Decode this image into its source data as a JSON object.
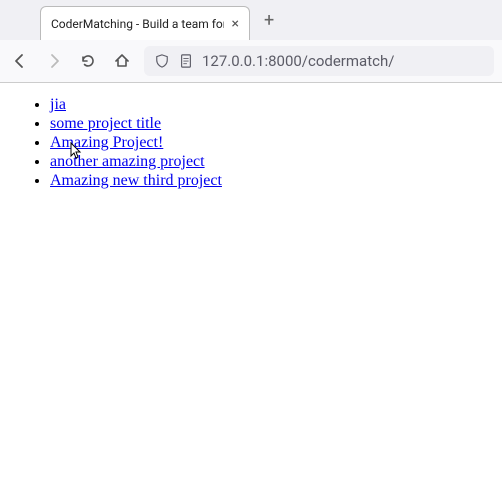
{
  "tab": {
    "title": "CoderMatching - Build a team for y"
  },
  "url": "127.0.0.1:8000/codermatch/",
  "links": [
    {
      "text": "jia"
    },
    {
      "text": "some project title"
    },
    {
      "text": "Amazing Project!"
    },
    {
      "text": "another amazing project"
    },
    {
      "text": "Amazing new third project"
    }
  ]
}
